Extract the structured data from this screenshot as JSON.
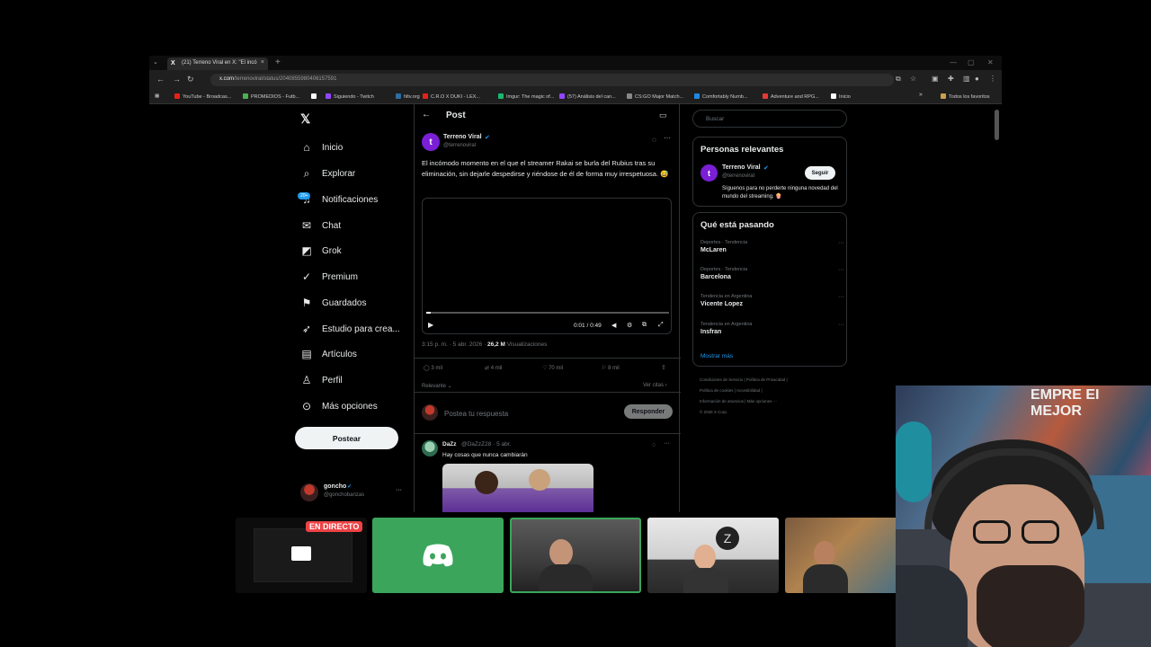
{
  "browser": {
    "tab_title": "(21) Terreno Viral en X: \"El incó",
    "tab_close": "×",
    "new_tab": "+",
    "url_domain": "x.com",
    "url_path": "/terrenoviral/status/2040855980406157591",
    "bookmarks": [
      {
        "label": "YouTube - Broadcas...",
        "color": "#e62117"
      },
      {
        "label": "PROMEDIOS - Futb...",
        "color": "#4caf50"
      },
      {
        "label": "",
        "color": "#ffffff"
      },
      {
        "label": "Siguiendo - Twitch",
        "color": "#9146ff"
      },
      {
        "label": "hltv.org",
        "color": "#2d6da3"
      },
      {
        "label": "C.R.O X DUKI - LEX...",
        "color": "#e62117"
      },
      {
        "label": "Imgur: The magic of...",
        "color": "#1bb76e"
      },
      {
        "label": "(57) Análisis del can...",
        "color": "#9146ff"
      },
      {
        "label": "CS:GO Major Match...",
        "color": "#888888"
      },
      {
        "label": "Comfortably Numb...",
        "color": "#1e88e5"
      },
      {
        "label": "Adventure and RPG...",
        "color": "#e53935"
      },
      {
        "label": "Inicio",
        "color": "#ffffff"
      }
    ],
    "bookmarks_more": "»",
    "all_bookmarks": "Todos los favoritos"
  },
  "nav": {
    "logo": "𝕏",
    "items": [
      {
        "icon": "⌂",
        "label": "Inicio"
      },
      {
        "icon": "⌕",
        "label": "Explorar"
      },
      {
        "icon": "♫",
        "label": "Notificaciones"
      },
      {
        "icon": "✉",
        "label": "Chat"
      },
      {
        "icon": "◩",
        "label": "Grok"
      },
      {
        "icon": "✓",
        "label": "Premium"
      },
      {
        "icon": "⚑",
        "label": "Guardados"
      },
      {
        "icon": "➶",
        "label": "Estudio para crea..."
      },
      {
        "icon": "▤",
        "label": "Artículos"
      },
      {
        "icon": "♙",
        "label": "Perfil"
      },
      {
        "icon": "⊙",
        "label": "Más opciones"
      }
    ],
    "notif_badge": "20+",
    "post_button": "Postear",
    "me": {
      "name": "goncho",
      "handle": "@gonchobanzas",
      "more": "···"
    }
  },
  "post": {
    "header_title": "Post",
    "back": "←",
    "author_name": "Terreno Viral",
    "author_handle": "@terrenoviral",
    "text": "El incómodo momento en el que el streamer Rakai se burla del Rubius tras su eliminación, sin dejarle despedirse y riéndose de él de forma muy irrespetuosa. 😅",
    "video_time": "0:01 / 0:49",
    "video_progress": 0.02,
    "meta_time": "3:15 p. m. · 5 abr. 2026 ·",
    "views_count": "26,2 M",
    "views_label": "Visualizaciones",
    "stats": {
      "replies": "3 mil",
      "reposts": "4 mil",
      "likes": "70 mil",
      "bookmarks": "8 mil"
    },
    "sort_label": "Relevante ⌄",
    "quotes_label": "Ver citas ›",
    "reply_placeholder": "Postea tu respuesta",
    "reply_button": "Responder"
  },
  "reply": {
    "name": "DaZz",
    "handle_time": "@DaZzZ28 · 5 abr.",
    "text": "Hay cosas que nunca cambiarán"
  },
  "right": {
    "search_placeholder": "Buscar",
    "relevant_title": "Personas relevantes",
    "relevant_name": "Terreno Viral",
    "relevant_handle": "@terrenoviral",
    "relevant_bio": "Síguenos para no perderte ninguna novedad del mundo del streaming. 🍿",
    "follow_button": "Seguir",
    "trending_title": "Qué está pasando",
    "trends": [
      {
        "category": "Deportes · Tendencia",
        "name": "McLaren"
      },
      {
        "category": "Deportes · Tendencia",
        "name": "Barcelona"
      },
      {
        "category": "Tendencia en Argentina",
        "name": "Vicente Lopez"
      },
      {
        "category": "Tendencia en Argentina",
        "name": "Insfran"
      }
    ],
    "show_more": "Mostrar más",
    "footer": [
      "Condiciones de Servicio  |  Política de Privacidad  |",
      "Política de cookies  |  Accesibilidad  |",
      "Información de anuncios  |  Más opciones ···",
      "© 2026 X Corp."
    ]
  },
  "stream": {
    "live_badge": "EN DIRECTO"
  }
}
